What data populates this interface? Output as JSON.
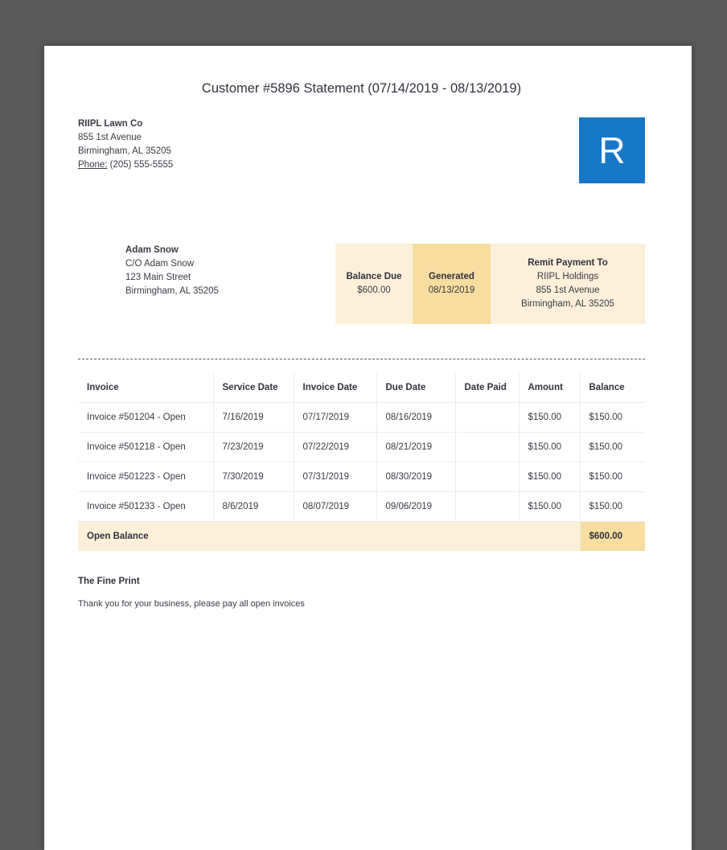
{
  "document": {
    "title": "Customer #5896 Statement (07/14/2019 - 08/13/2019)",
    "company": {
      "name": "RIIPL Lawn Co",
      "address1": "855 1st Avenue",
      "address2": "Birmingham, AL 35205",
      "phone_label": "Phone:",
      "phone": " (205) 555-5555"
    },
    "logo_letter": "R",
    "customer": {
      "name": "Adam Snow",
      "line1": "C/O Adam Snow",
      "line2": "123 Main Street",
      "line3": "Birmingham, AL 35205"
    },
    "summary": {
      "balance_due_label": "Balance Due",
      "balance_due_value": "$600.00",
      "generated_label": "Generated",
      "generated_value": "08/13/2019",
      "remit_label": "Remit Payment To",
      "remit_line1": "RIIPL Holdings",
      "remit_line2": "855 1st Avenue",
      "remit_line3": "Birmingham, AL 35205"
    },
    "table": {
      "headers": [
        "Invoice",
        "Service Date",
        "Invoice Date",
        "Due Date",
        "Date Paid",
        "Amount",
        "Balance"
      ],
      "rows": [
        [
          "Invoice #501204 - Open",
          "7/16/2019",
          "07/17/2019",
          "08/16/2019",
          "",
          "$150.00",
          "$150.00"
        ],
        [
          "Invoice #501218 - Open",
          "7/23/2019",
          "07/22/2019",
          "08/21/2019",
          "",
          "$150.00",
          "$150.00"
        ],
        [
          "Invoice #501223 - Open",
          "7/30/2019",
          "07/31/2019",
          "08/30/2019",
          "",
          "$150.00",
          "$150.00"
        ],
        [
          "Invoice #501233 - Open",
          "8/6/2019",
          "08/07/2019",
          "09/06/2019",
          "",
          "$150.00",
          "$150.00"
        ]
      ],
      "footer_label": "Open Balance",
      "footer_balance": "$600.00"
    },
    "fine_print_title": "The Fine Print",
    "fine_print_text": "Thank you for your business, please pay all open invoices"
  },
  "colors": {
    "accent_blue": "#1778c8",
    "tan_light": "#fcf0d9",
    "tan_dark": "#f8dda1",
    "backdrop_gray": "#595959",
    "text_dark": "#32323e"
  }
}
